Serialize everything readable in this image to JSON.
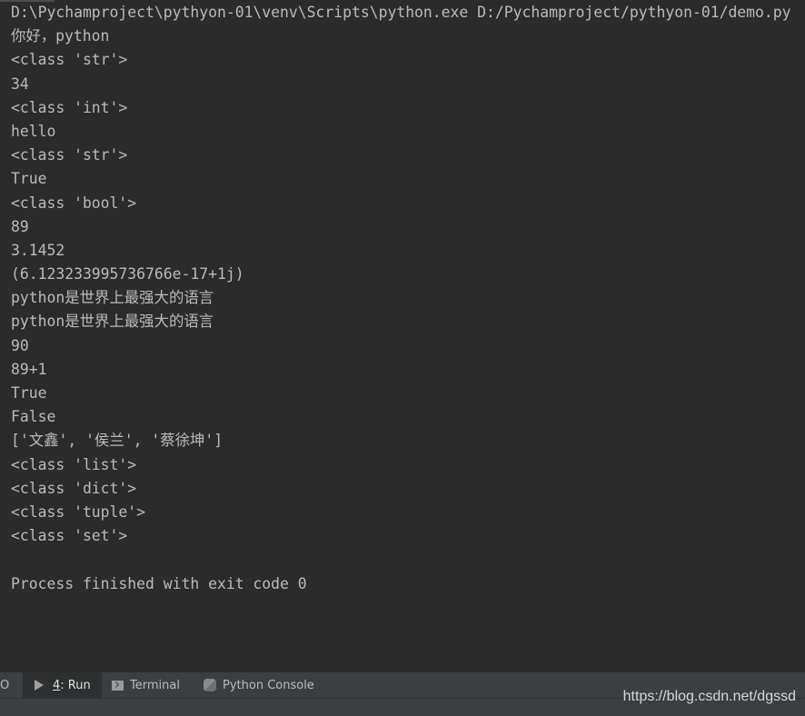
{
  "console": {
    "lines": [
      "D:\\Pychamproject\\pythyon-01\\venv\\Scripts\\python.exe D:/Pychamproject/pythyon-01/demo.py",
      "你好，python",
      "<class 'str'>",
      "34",
      "<class 'int'>",
      "hello",
      "<class 'str'>",
      "True",
      "<class 'bool'>",
      "89",
      "3.1452",
      "(6.123233995736766e-17+1j)",
      "python是世界上最强大的语言",
      "python是世界上最强大的语言",
      "90",
      "89+1",
      "True",
      "False",
      "['文鑫', '侯兰', '蔡徐坤']",
      "<class 'list'>",
      "<class 'dict'>",
      "<class 'tuple'>",
      "<class 'set'>",
      "",
      "Process finished with exit code 0"
    ]
  },
  "toolbar": {
    "left_cut_label": "O",
    "run_mnemonic": "4",
    "run_label": ": Run",
    "terminal_label": "Terminal",
    "python_console_label": "Python Console"
  },
  "watermark": "https://blog.csdn.net/dgssd",
  "colors": {
    "background": "#2b2b2b",
    "text": "#bbbbbb",
    "toolbar": "#3c3f41"
  }
}
